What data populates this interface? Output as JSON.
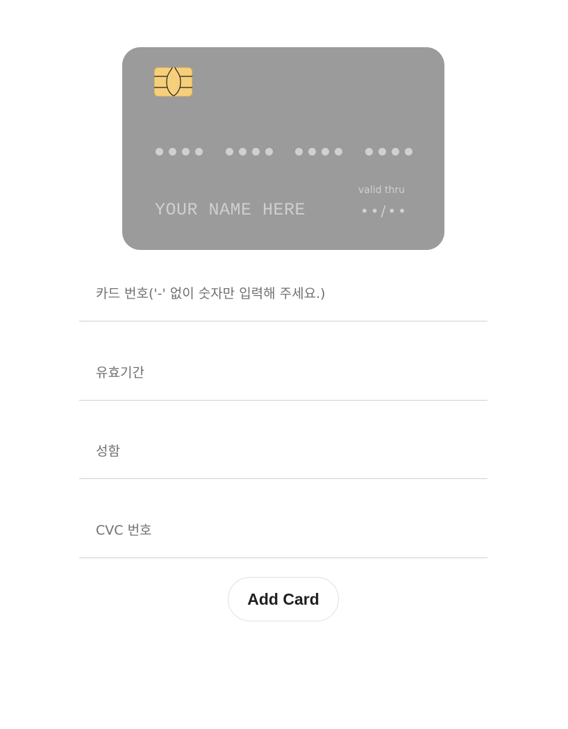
{
  "card_preview": {
    "number_placeholder_groups": 4,
    "dots_per_group": 4,
    "name_placeholder": "YOUR NAME HERE",
    "valid_thru_label": "valid thru",
    "expiry_placeholder": "••/••",
    "card_color": "#9b9b9b",
    "chip_color": "#f5cf7a"
  },
  "form": {
    "card_number_placeholder": "카드 번호('-' 없이 숫자만 입력해 주세요.)",
    "expiry_placeholder": "유효기간",
    "name_placeholder": "성함",
    "cvc_placeholder": "CVC 번호",
    "submit_label": "Add Card"
  }
}
